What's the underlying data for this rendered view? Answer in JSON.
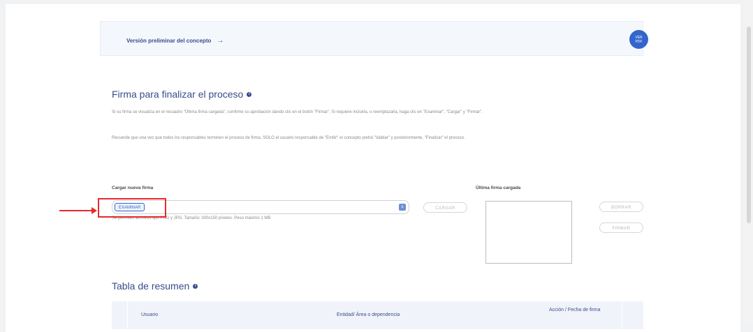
{
  "preview": {
    "link_label": "Versión preliminar del concepto",
    "arrow": "→",
    "pdf_line1": "VER",
    "pdf_line2": "PDF"
  },
  "signature_section": {
    "title": "Firma para finalizar el proceso",
    "paragraph1": "Si su firma se visualiza en el recuadro \"Última firma cargada\", confirme su aprobación dando clic en el botón \"Firmar\". Si requiere incluirla, o reemplazarla, haga clic en \"Examinar\", \"Cargar\" y \"Firmar\".",
    "paragraph2": "Recuerde que una vez que todos los responsables terminen el proceso de firma, SOLO el usuario responsable de \"Emitir\" el concepto podrá \"Validar\" y posteriormente, \"Finalizar\" el proceso.",
    "upload_label": "Cargar nueva firma",
    "browse_button": "EXAMINAR",
    "clear_icon": "x",
    "hint": "Se permiten archivos tipo PNG y JPG. Tamaño: 300x150 píxeles. Peso máximo 1 MB",
    "load_button": "CARGAR",
    "last_signature_label": "Última firma cargada",
    "delete_button": "BORRAR",
    "sign_button": "FIRMAR"
  },
  "summary_table": {
    "title": "Tabla de resumen",
    "columns": [
      "Usuario",
      "Entidad/ Área o dependencia",
      "Acción / Fecha de firma"
    ]
  },
  "colors": {
    "accent": "#3366cc",
    "title": "#3a4c8c",
    "annotation": "#e8282d"
  },
  "icons": [
    "arrow-right-icon",
    "pdf-icon",
    "info-icon",
    "clear-icon",
    "annotation-arrow-icon"
  ]
}
